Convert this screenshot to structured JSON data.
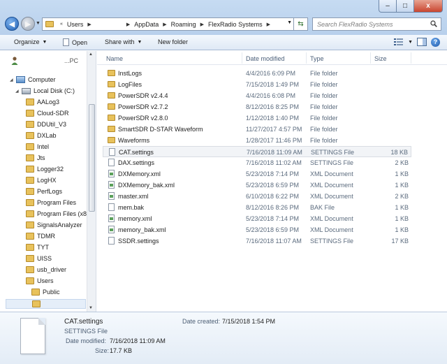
{
  "window": {
    "minimize_glyph": "–",
    "maximize_glyph": "□",
    "close_glyph": "x"
  },
  "address": {
    "segments": [
      "Users",
      "AppData",
      "Roaming",
      "FlexRadio Systems"
    ]
  },
  "search": {
    "placeholder": "Search FlexRadio Systems"
  },
  "toolbar": {
    "organize": "Organize",
    "open": "Open",
    "share_with": "Share with",
    "new_folder": "New folder"
  },
  "nav": {
    "user_suffix": "...PC",
    "items": [
      {
        "label": "Computer",
        "icon": "computer-icon"
      },
      {
        "label": "Local Disk (C:)",
        "icon": "disk-icon"
      },
      {
        "label": "AALog3"
      },
      {
        "label": "Cloud-SDR"
      },
      {
        "label": "DDUtil_V3"
      },
      {
        "label": "DXLab"
      },
      {
        "label": "Intel"
      },
      {
        "label": "Jts"
      },
      {
        "label": "Logger32"
      },
      {
        "label": "LogHX"
      },
      {
        "label": "PerfLogs"
      },
      {
        "label": "Program Files"
      },
      {
        "label": "Program Files (x86"
      },
      {
        "label": "SignalsAnalyzer"
      },
      {
        "label": "TDMR"
      },
      {
        "label": "TYT"
      },
      {
        "label": "UISS"
      },
      {
        "label": "usb_driver"
      },
      {
        "label": "Users"
      },
      {
        "label": "Public"
      }
    ]
  },
  "columns": {
    "name": "Name",
    "date": "Date modified",
    "type": "Type",
    "size": "Size"
  },
  "files": [
    {
      "name": "InstLogs",
      "date": "4/4/2016 6:09 PM",
      "type": "File folder",
      "size": "",
      "icon": "folder"
    },
    {
      "name": "LogFiles",
      "date": "7/15/2018 1:49 PM",
      "type": "File folder",
      "size": "",
      "icon": "folder"
    },
    {
      "name": "PowerSDR v2.4.4",
      "date": "4/4/2016 6:08 PM",
      "type": "File folder",
      "size": "",
      "icon": "folder"
    },
    {
      "name": "PowerSDR v2.7.2",
      "date": "8/12/2016 8:25 PM",
      "type": "File folder",
      "size": "",
      "icon": "folder"
    },
    {
      "name": "PowerSDR v2.8.0",
      "date": "1/12/2018 1:40 PM",
      "type": "File folder",
      "size": "",
      "icon": "folder"
    },
    {
      "name": "SmartSDR D-STAR Waveform",
      "date": "11/27/2017 4:57 PM",
      "type": "File folder",
      "size": "",
      "icon": "folder"
    },
    {
      "name": "Waveforms",
      "date": "1/28/2017 11:46 PM",
      "type": "File folder",
      "size": "",
      "icon": "folder"
    },
    {
      "name": "CAT.settings",
      "date": "7/16/2018 11:09 AM",
      "type": "SETTINGS File",
      "size": "18 KB",
      "icon": "file"
    },
    {
      "name": "DAX.settings",
      "date": "7/16/2018 11:02 AM",
      "type": "SETTINGS File",
      "size": "2 KB",
      "icon": "file"
    },
    {
      "name": "DXMemory.xml",
      "date": "5/23/2018 7:14 PM",
      "type": "XML Document",
      "size": "1 KB",
      "icon": "xml"
    },
    {
      "name": "DXMemory_bak.xml",
      "date": "5/23/2018 6:59 PM",
      "type": "XML Document",
      "size": "1 KB",
      "icon": "xml"
    },
    {
      "name": "master.xml",
      "date": "6/10/2018 6:22 PM",
      "type": "XML Document",
      "size": "2 KB",
      "icon": "xml"
    },
    {
      "name": "mem.bak",
      "date": "8/12/2016 8:26 PM",
      "type": "BAK File",
      "size": "1 KB",
      "icon": "file"
    },
    {
      "name": "memory.xml",
      "date": "5/23/2018 7:14 PM",
      "type": "XML Document",
      "size": "1 KB",
      "icon": "xml"
    },
    {
      "name": "memory_bak.xml",
      "date": "5/23/2018 6:59 PM",
      "type": "XML Document",
      "size": "1 KB",
      "icon": "xml"
    },
    {
      "name": "SSDR.settings",
      "date": "7/16/2018 11:07 AM",
      "type": "SETTINGS File",
      "size": "17 KB",
      "icon": "file"
    }
  ],
  "details": {
    "name": "CAT.settings",
    "type": "SETTINGS File",
    "modified_label": "Date modified:",
    "modified": "7/16/2018 11:09 AM",
    "size_label": "Size:",
    "size": "17.7 KB",
    "created_label": "Date created:",
    "created": "7/15/2018 1:54 PM"
  }
}
